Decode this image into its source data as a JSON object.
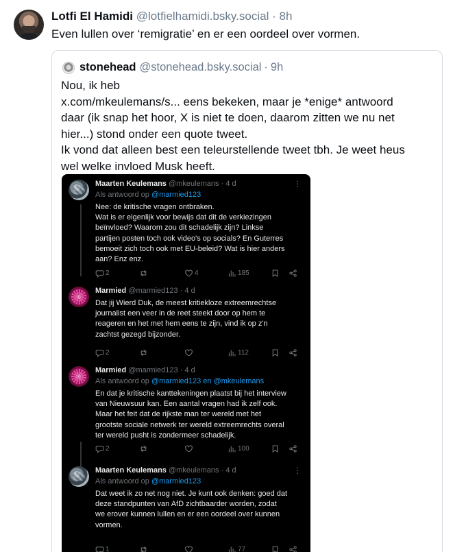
{
  "post": {
    "author_name": "Lotfi El Hamidi",
    "author_handle": "@lotfielhamidi.bsky.social",
    "separator": "·",
    "time": "8h",
    "text": "Even lullen over ‘remigratie’ en er een oordeel over vormen."
  },
  "quote": {
    "author_name": "stonehead",
    "author_handle": "@stonehead.bsky.social",
    "separator": "·",
    "time": "9h",
    "lines": [
      "Nou, ik heb",
      "x.com/mkeulemans/s... eens bekeken, maar je *enige* antwoord",
      "daar (ik snap het hoor, X is niet te doen, daarom zitten we nu net",
      "hier...) stond onder een quote tweet.",
      "Ik vond dat alleen best een teleurstellende tweet tbh. Je weet heus",
      "wel welke invloed Musk heeft."
    ]
  },
  "screenshot": {
    "more_icon": "more-dots-icon",
    "tweets": [
      {
        "name": "Maarten Keulemans",
        "handle": "@mkeulemans",
        "separator": "·",
        "time": "4 d",
        "reply_prefix": "Als antwoord op ",
        "reply_mentions": "@marmied123",
        "lines": [
          "Nee: de kritische vragen ontbraken.",
          "Wat is er eigenlijk voor bewijs dat dit de verkiezingen",
          "beïnvloed? Waarom zou dit schadelijk zijn? Linkse",
          "partijen posten toch ook video's op socials? En Guterres",
          "bemoeit zich toch ook met EU-beleid? Wat is hier anders",
          "aan? Enz enz."
        ],
        "replies": "2",
        "reposts": "",
        "likes": "4",
        "views": "185"
      },
      {
        "name": "Marmied",
        "handle": "@marmied123",
        "separator": "·",
        "time": "4 d",
        "lines": [
          "Dat jij Wierd Duk, de meest kritiekloze extreemrechtse",
          "journalist een veer in de reet steekt door op hem te",
          "reageren en het met hem eens te zijn, vind ik op z'n",
          "zachtst gezegd bijzonder."
        ],
        "replies": "2",
        "reposts": "",
        "likes": "",
        "views": "112"
      },
      {
        "name": "Marmied",
        "handle": "@marmied123",
        "separator": "·",
        "time": "4 d",
        "reply_prefix": "Als antwoord op ",
        "reply_mentions": "@marmied123 en @mkeulemans",
        "lines": [
          "En dat je kritische kanttekeningen plaatst bij het interview",
          "van Nieuwsuur kan. Een aantal vragen had ik zelf ook.",
          "Maar het feit dat de rijkste man ter wereld met het",
          "grootste sociale netwerk ter wereld extreemrechts overal",
          "ter wereld pusht is zondermeer schadelijk."
        ],
        "replies": "2",
        "reposts": "",
        "likes": "",
        "views": "100"
      },
      {
        "name": "Maarten Keulemans",
        "handle": "@mkeulemans",
        "separator": "·",
        "time": "4 d",
        "reply_prefix": "Als antwoord op ",
        "reply_mentions": "@marmied123",
        "lines": [
          "Dat weet ik zo net nog niet. Je kunt ook denken: goed dat",
          "deze standpunten van AfD zichtbaarder worden, zodat",
          "we erover kunnen lullen en er een oordeel over kunnen",
          "vormen."
        ],
        "replies": "1",
        "reposts": "",
        "likes": "",
        "views": "77"
      }
    ]
  }
}
